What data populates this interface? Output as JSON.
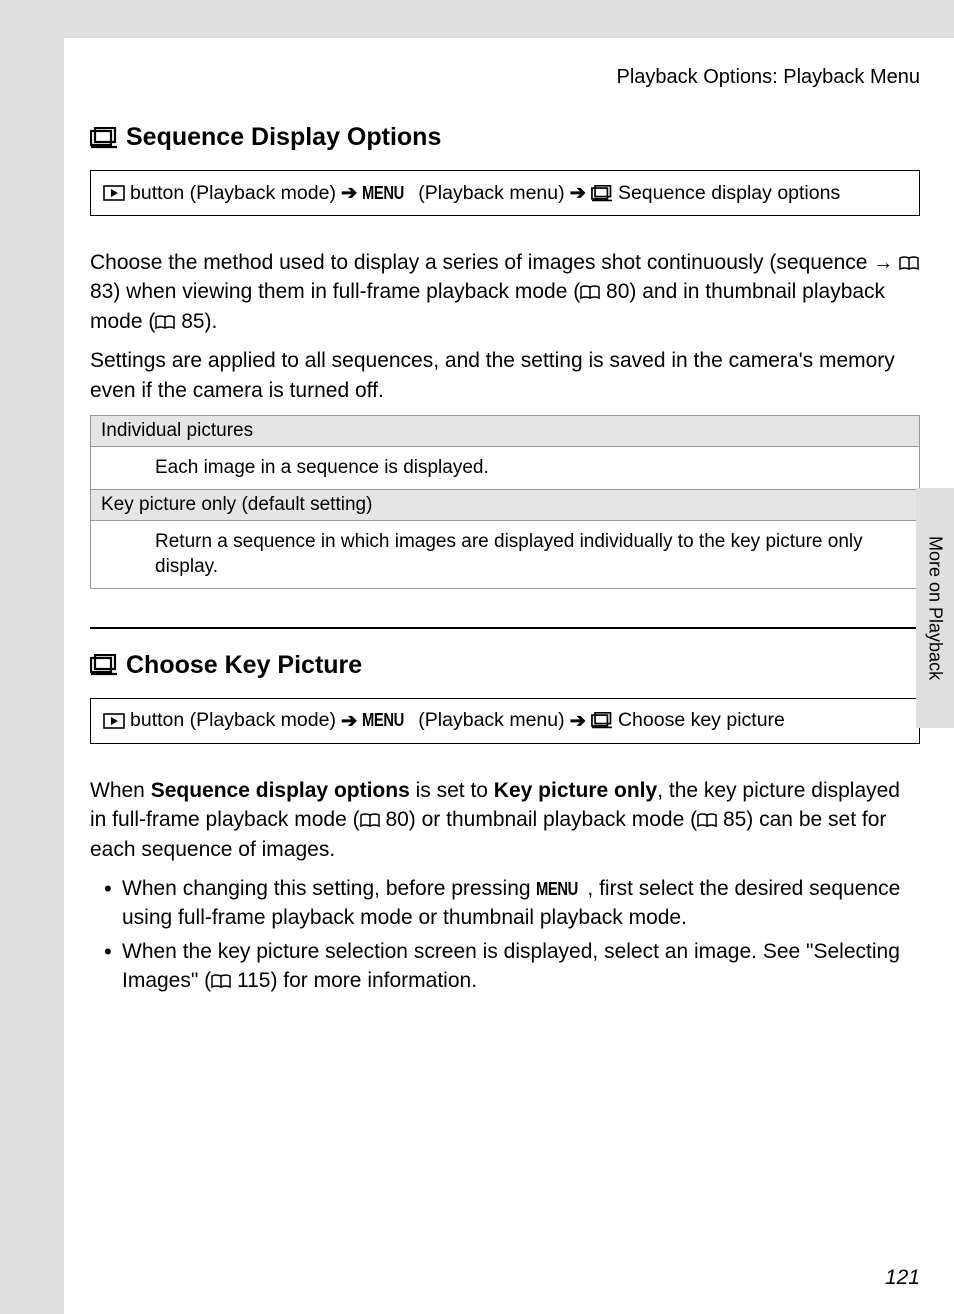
{
  "header": "Playback Options: Playback Menu",
  "sideTab": "More on Playback",
  "pageNumber": "121",
  "menuWord": "MENU",
  "section1": {
    "title": "Sequence Display Options",
    "crumb": {
      "part1": "button (Playback mode)",
      "part2": "(Playback menu)",
      "part3": "Sequence display options"
    },
    "para1a": "Choose the method used to display a series of images shot continuously (sequence ",
    "para1b": " 83) when viewing them in full-frame playback mode (",
    "para1c": " 80) and in thumbnail playback mode (",
    "para1d": " 85).",
    "para2": "Settings are applied to all sequences, and the setting is saved in the camera's memory even if the camera is turned off.",
    "opt1Title": "Individual pictures",
    "opt1Body": "Each image in a sequence is displayed.",
    "opt2Title": "Key picture only (default setting)",
    "opt2Body": "Return a sequence in which images are displayed individually to the key picture only display."
  },
  "section2": {
    "title": "Choose Key Picture",
    "crumb": {
      "part1": "button (Playback mode)",
      "part2": "(Playback menu)",
      "part3": "Choose key picture"
    },
    "para1a": "When ",
    "para1b": "Sequence display options",
    "para1c": " is set to ",
    "para1d": "Key picture only",
    "para1e": ", the key picture displayed in full-frame playback mode (",
    "para1f": " 80) or thumbnail playback mode (",
    "para1g": " 85) can be set for each sequence of images.",
    "bullet1a": "When changing this setting, before pressing ",
    "bullet1b": ", first select the desired sequence using full-frame playback mode or thumbnail playback mode.",
    "bullet2a": "When the key picture selection screen is displayed, select an image. See \"Selecting Images\" (",
    "bullet2b": " 115) for more information."
  }
}
